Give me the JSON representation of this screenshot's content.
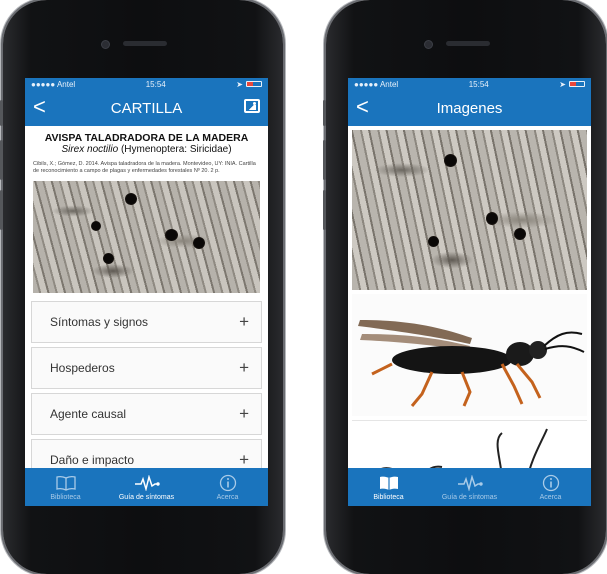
{
  "left_phone": {
    "status": {
      "carrier": "●●●●● Antel",
      "time": "15:54"
    },
    "nav": {
      "title": "CARTILLA",
      "back_label": "<"
    },
    "card": {
      "title": "AVISPA TALADRADORA DE LA MADERA",
      "scientific_name": "Sirex noctilio",
      "taxonomy": "(Hymenoptera: Siricidae)",
      "citation": "Cibils, X.; Gómez, D. 2014. Avispa taladradora de la madera. Montevideo, UY: INIA. Cartilla de reconocimiento a campo de plagas y enfermedades forestales Nº 20. 2 p."
    },
    "sections": [
      {
        "label": "Síntomas y signos",
        "toggle": "+"
      },
      {
        "label": "Hospederos",
        "toggle": "+"
      },
      {
        "label": "Agente causal",
        "toggle": "+"
      },
      {
        "label": "Daño e impacto",
        "toggle": "+"
      }
    ],
    "tabs": [
      {
        "label": "Biblioteca",
        "icon": "book-icon"
      },
      {
        "label": "Guía de síntomas",
        "icon": "pulse-icon"
      },
      {
        "label": "Acerca",
        "icon": "info-icon"
      }
    ],
    "active_tab": "Guía de síntomas"
  },
  "right_phone": {
    "status": {
      "carrier": "●●●●● Antel",
      "time": "15:54"
    },
    "nav": {
      "title": "Imagenes",
      "back_label": "<"
    },
    "tabs": [
      {
        "label": "Biblioteca",
        "icon": "book-icon"
      },
      {
        "label": "Guía de síntomas",
        "icon": "pulse-icon"
      },
      {
        "label": "Acerca",
        "icon": "info-icon"
      }
    ],
    "active_tab": "Biblioteca"
  },
  "colors": {
    "accent": "#1a74bd",
    "phone_body": "#0d0e10"
  }
}
